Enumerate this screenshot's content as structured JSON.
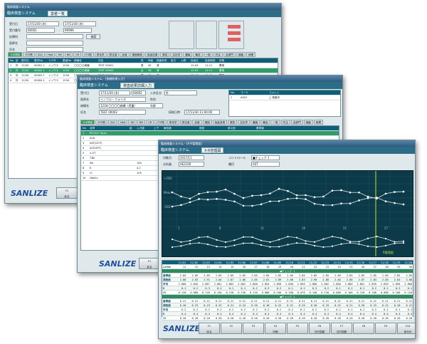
{
  "win1": {
    "title": "臨床検査システム",
    "app_title": "臨床検査システム",
    "subtab": "患者一覧",
    "fields": {
      "label_date": "受付日",
      "date_from": "17/11/30 (木)",
      "date_to": "17/11/30 (木)",
      "label_no": "受付番号",
      "no_from": "00001",
      "no_to": "99999",
      "label_dept": "診療科",
      "label_doctor": "医師名",
      "label_name": "氏名",
      "search_label": "検索"
    },
    "tabs": [
      "ラボ測定",
      "STS物",
      "GLU",
      "HbA",
      "HD",
      "BD",
      "CR",
      "CTS物",
      "尿化学",
      "尿沈渣",
      "血液",
      "凝固線溶",
      "免疫血清",
      "緊急",
      "生化学",
      "腫瘍",
      "輸血",
      "一般",
      "外注",
      "全部門",
      "細菌",
      "病理"
    ],
    "grid_header": [
      "No",
      "区",
      "受付日",
      "受付No",
      "ドクタ",
      "患者No",
      "病棟名",
      "氏名",
      "性",
      "年齢",
      "検査状況",
      "処方",
      "入院",
      "採血日",
      "採血時刻",
      "状態"
    ],
    "grid_rows": [
      [
        "1",
        "外",
        "11/30",
        "00001 1",
        "イノウエ",
        "1234",
        "〇〇〇〇病棟",
        "TEST 00001",
        "男",
        "45",
        "済",
        "",
        "",
        "12:43",
        "11:11",
        "異常"
      ],
      [
        "2",
        "外",
        "11/30",
        "00002 1",
        "イノウエ",
        "1234",
        "〇〇〇〇病棟",
        "TEST 00002",
        "女",
        "38",
        "済",
        "",
        "",
        "12:43",
        "11:11",
        "異常"
      ],
      [
        "3",
        "外",
        "11/30",
        "00003 1",
        "イノウエ",
        "1234",
        "〇〇〇〇病棟",
        "TEST 00003",
        "男",
        "62",
        "済",
        "",
        "",
        "12:43",
        "11:11",
        "異常"
      ],
      [
        "4",
        "外",
        "11/30",
        "00004 1",
        "イノウエ",
        "1234",
        "〇〇〇〇病棟",
        "TEST 00004",
        "女",
        "51",
        "済",
        "",
        "",
        "12:43",
        "11:11",
        "異常"
      ]
    ],
    "fkeys": [
      "F1",
      "F2"
    ],
    "fkey_labels": [
      "戻る",
      ""
    ],
    "logo": "SANLIZE"
  },
  "win2": {
    "title": "臨床検査システム - [依頼結果入力]",
    "app_title": "臨床検査システム",
    "subtab": "検査結果詳細入力",
    "fields": {
      "label_date": "受付日",
      "date": "17/11/30 (木)",
      "no": "00002",
      "label_inpatient": "入外区分",
      "inpatient": "外",
      "label_doctor": "医師名",
      "doctor": "イノウエ・フォリオ",
      "label_ward": "病棟名",
      "ward": "1234:〇〇〇〇病棟（児童）",
      "label_name": "氏名",
      "name": "TEST 00002",
      "label_sex": "性別",
      "label_age": "年齢",
      "label_blood": "採取日時",
      "blood": "17/11/30 11:00:00"
    },
    "comment_header": [
      "No",
      "コード",
      "コメント"
    ],
    "comment_row": [
      "1",
      "A001",
      "□ 検査中"
    ],
    "tabs": [
      "ラボ測定",
      "STS物",
      "GLU",
      "HbA",
      "HD",
      "BD",
      "CR",
      "CTS物",
      "尿化学",
      "尿沈渣",
      "血液",
      "凝固",
      "免疫血清",
      "緊急",
      "生化学",
      "腫瘍",
      "輸血",
      "一般",
      "外注",
      "全部門",
      "細菌",
      "病理"
    ],
    "grid_header": [
      "No",
      "名称",
      "結",
      "入力値",
      "上下",
      "報告値",
      "前回",
      "前々回",
      "基準値"
    ],
    "grid_rows": [
      [
        "1",
        "PLT(10^4/μL)",
        "",
        "",
        "",
        "",
        "",
        "",
        ""
      ],
      [
        "2",
        "ALB",
        "",
        "",
        "",
        "",
        "",
        "",
        ""
      ],
      [
        "3",
        "AST(GOT)",
        "",
        "",
        "",
        "",
        "",
        "",
        ""
      ],
      [
        "4",
        "ALT(GPT)",
        "",
        "",
        "",
        "",
        "",
        "",
        ""
      ],
      [
        "5",
        "γ-GT",
        "",
        "",
        "",
        "",
        "",
        "",
        ""
      ],
      [
        "6",
        "T.Bil",
        "",
        "",
        "",
        "",
        "",
        "",
        ""
      ],
      [
        "7",
        "Na",
        "",
        "140",
        "",
        "",
        "",
        "",
        ""
      ],
      [
        "8",
        "K",
        "",
        "4.2",
        "",
        "",
        "",
        "",
        ""
      ],
      [
        "9",
        "Cl",
        "",
        "105",
        "",
        "",
        "",
        "",
        ""
      ],
      [
        "10",
        "HbA1c",
        "",
        "",
        "",
        "",
        "",
        "",
        ""
      ]
    ],
    "fkeys": [
      "F1",
      "F2"
    ],
    "fkey_labels": [
      "戻る",
      "全選択"
    ],
    "logo": "SANLIZE"
  },
  "win3": {
    "title": "臨床検査システム - [X-R管理図]",
    "app_title": "臨床検査システム",
    "subtab": "X-R管理図",
    "fields": {
      "label_month": "対象月",
      "month": "2017/11",
      "label_item": "分析器",
      "item": "AE2100",
      "label_control": "コントロール",
      "control": "■チェック 1",
      "label_kind": "種目",
      "kind": "AST"
    },
    "dates": [
      "11/01",
      "11/02",
      "11/03",
      "11/04",
      "11/05",
      "11/06",
      "11/07",
      "11/08",
      "11/09",
      "11/10",
      "11/11",
      "11/12",
      "11/13",
      "11/14",
      "11/15",
      "11/16",
      "11/17",
      "11/18",
      "11/19",
      "11/20"
    ],
    "lot_row": [
      "LotNo",
      "11",
      "12",
      "13",
      "14",
      "15",
      "16",
      "17",
      "18",
      "19",
      "20",
      "21",
      "22",
      "23",
      "24",
      "25",
      "26",
      "27",
      "28",
      "29",
      "30"
    ],
    "chart_x_labels": [
      "1",
      "6",
      "11",
      "16",
      "21",
      "27"
    ],
    "chart_y_labels": [
      "+2SD",
      "Mean",
      "-2SD"
    ],
    "r_chart_label": "R管理図",
    "table_sections": [
      {
        "header": "■チェック 1",
        "rows": [
          [
            "基準値",
            "2.85",
            "2.85",
            "2.85",
            "2.85",
            "2.85",
            "2.85",
            "2.85",
            "2.85",
            "2.85",
            "2.85",
            "2.85",
            "2.85",
            "2.85",
            "2.85",
            "2.85",
            "2.85",
            "2.85",
            "2.85",
            "2.85",
            "2.85"
          ],
          [
            "測定値",
            "2.86",
            "2.83",
            "2.91",
            "2.84",
            "2.87",
            "2.86",
            "2.85",
            "2.81",
            "2.89",
            "2.86",
            "2.83",
            "2.90",
            "2.88",
            "2.84",
            "2.86",
            "2.87",
            "2.83",
            "2.85",
            "2.84",
            "2.88"
          ],
          [
            "平均",
            "2.860",
            "2.845",
            "2.867",
            "2.861",
            "2.862",
            "2.862",
            "2.860",
            "2.854",
            "2.858",
            "2.858",
            "2.856",
            "2.860",
            "2.862",
            "2.860",
            "2.860",
            "2.861",
            "2.859",
            "2.859",
            "2.858",
            "2.860"
          ],
          [
            "R",
            "0.1",
            "0.2",
            "0.3",
            "0.2",
            "0.1",
            "0.1",
            "0.2",
            "0.3",
            "0.2",
            "0.1",
            "0.2",
            "0.3",
            "0.2",
            "0.1",
            "0.2",
            "0.1",
            "0.2",
            "0.1",
            "0.2",
            "0.1"
          ],
          [
            "CV",
            "0.120",
            "0.080",
            "0.120",
            "0.150",
            "0.120",
            "0.130",
            "0.110",
            "0.080",
            "0.100",
            "0.100",
            "0.070",
            "0.140",
            "0.120",
            "0.080",
            "0.100",
            "0.120",
            "0.100",
            "0.080",
            "0.100",
            "0.120"
          ]
        ]
      },
      {
        "header": "■チェック 2",
        "rows": [
          [
            "基準値",
            "6.21",
            "6.21",
            "6.21",
            "6.21",
            "6.21",
            "6.21",
            "6.21",
            "6.21",
            "6.21",
            "6.21",
            "6.21",
            "6.21",
            "6.21",
            "6.21",
            "6.21",
            "6.21",
            "6.21",
            "6.21",
            "6.21",
            "6.21"
          ],
          [
            "測定値",
            "6.20",
            "6.23",
            "6.19",
            "6.22",
            "6.21",
            "6.24",
            "6.20",
            "6.18",
            "6.22",
            "6.21",
            "6.25",
            "6.20",
            "6.19",
            "6.22",
            "6.21",
            "6.20",
            "6.23",
            "6.22",
            "6.20",
            "6.21"
          ],
          [
            "平均",
            "6.2",
            "6.2",
            "6.2",
            "6.2",
            "6.2",
            "6.2",
            "6.2",
            "6.2",
            "6.2",
            "6.2",
            "6.2",
            "6.2",
            "6.2",
            "6.2",
            "6.2",
            "6.2",
            "6.2",
            "6.2",
            "6.2",
            "6.2"
          ],
          [
            "R",
            "0.4",
            "0.4",
            "0.4",
            "0.4",
            "0.4",
            "0.4",
            "0.4",
            "0.4",
            "0.4",
            "0.4",
            "0.4",
            "0.4",
            "0.4",
            "0.4",
            "0.4",
            "0.4",
            "0.4",
            "0.4",
            "0.4",
            "0.4"
          ],
          [
            "CV",
            "0.20",
            "0.20",
            "0.20",
            "0.20",
            "0.20",
            "0.20",
            "0.20",
            "0.20",
            "0.20",
            "0.20",
            "0.20",
            "0.20",
            "0.20",
            "0.20",
            "0.20",
            "0.20",
            "0.20",
            "0.20",
            "0.20",
            "0.20"
          ]
        ]
      }
    ],
    "fkeys": [
      "F1",
      "F2",
      "F3",
      "F4",
      "F5",
      "F6",
      "F7",
      "F8",
      "F9",
      "F10",
      "F11",
      "F12"
    ],
    "fkey_labels": [
      "戻る",
      "",
      "",
      "印刷",
      "",
      "日内変動",
      "日内変動",
      "",
      "",
      "前月分",
      "次月分",
      ""
    ],
    "logo": "SANLIZE"
  },
  "colors": {
    "chart_bg": "#0c3a48",
    "chart_line": "#dfe7ea",
    "limit_line": "#c4e23a",
    "grid_header": "#0e5f7a",
    "selected_row": "#2e9e6a",
    "accent_green": "#3a9a5a"
  }
}
